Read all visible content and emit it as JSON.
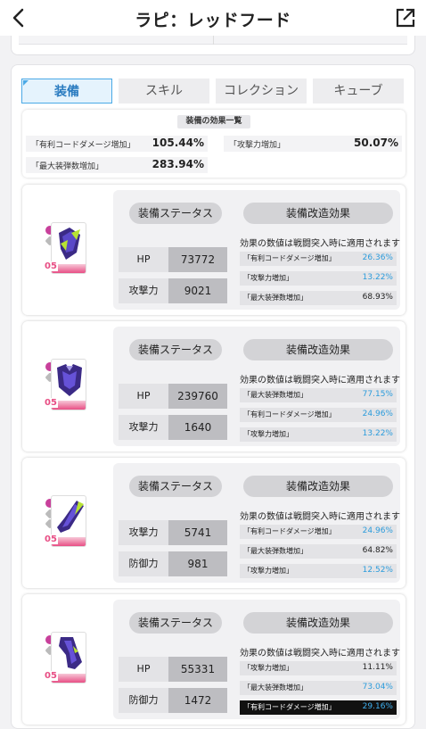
{
  "header": {
    "title": "ラピ：レッドフード",
    "back_icon": "chevron-left-icon",
    "share_icon": "external-link-icon"
  },
  "tabs": [
    {
      "label": "装備",
      "active": true
    },
    {
      "label": "スキル",
      "active": false
    },
    {
      "label": "コレクション",
      "active": false
    },
    {
      "label": "キューブ",
      "active": false
    }
  ],
  "effects_summary": {
    "title": "装備の効果一覧",
    "items": [
      {
        "label": "「有利コードダメージ増加」",
        "value": "105.44%"
      },
      {
        "label": "「攻撃力増加」",
        "value": "50.07%"
      },
      {
        "label": "「最大装弾数増加」",
        "value": "283.94%"
      }
    ]
  },
  "equipment": [
    {
      "level": "05",
      "status_label": "装備ステータス",
      "mod_label": "装備改造効果",
      "note": "効果の数値は戦闘突入時に適用されます",
      "stats": [
        {
          "label": "HP",
          "value": "73772"
        },
        {
          "label": "攻撃力",
          "value": "9021"
        }
      ],
      "mods": [
        {
          "label": "「有利コードダメージ増加」",
          "value": "26.36%",
          "color": "blue"
        },
        {
          "label": "「攻撃力増加」",
          "value": "13.22%",
          "color": "blue"
        },
        {
          "label": "「最大装弾数増加」",
          "value": "68.93%",
          "color": "black"
        }
      ]
    },
    {
      "level": "05",
      "status_label": "装備ステータス",
      "mod_label": "装備改造効果",
      "note": "効果の数値は戦闘突入時に適用されます",
      "stats": [
        {
          "label": "HP",
          "value": "239760"
        },
        {
          "label": "攻撃力",
          "value": "1640"
        }
      ],
      "mods": [
        {
          "label": "「最大装弾数増加」",
          "value": "77.15%",
          "color": "blue"
        },
        {
          "label": "「有利コードダメージ増加」",
          "value": "24.96%",
          "color": "blue"
        },
        {
          "label": "「攻撃力増加」",
          "value": "13.22%",
          "color": "blue"
        }
      ]
    },
    {
      "level": "05",
      "status_label": "装備ステータス",
      "mod_label": "装備改造効果",
      "note": "効果の数値は戦闘突入時に適用されます",
      "stats": [
        {
          "label": "攻撃力",
          "value": "5741"
        },
        {
          "label": "防御力",
          "value": "981"
        }
      ],
      "mods": [
        {
          "label": "「有利コードダメージ増加」",
          "value": "24.96%",
          "color": "blue"
        },
        {
          "label": "「最大装弾数増加」",
          "value": "64.82%",
          "color": "black"
        },
        {
          "label": "「攻撃力増加」",
          "value": "12.52%",
          "color": "blue"
        }
      ]
    },
    {
      "level": "05",
      "status_label": "装備ステータス",
      "mod_label": "装備改造効果",
      "note": "効果の数値は戦闘突入時に適用されます",
      "stats": [
        {
          "label": "HP",
          "value": "55331"
        },
        {
          "label": "防御力",
          "value": "1472"
        }
      ],
      "mods": [
        {
          "label": "「攻撃力増加」",
          "value": "11.11%",
          "color": "black"
        },
        {
          "label": "「最大装弾数増加」",
          "value": "73.04%",
          "color": "blue"
        },
        {
          "label": "「有利コードダメージ増加」",
          "value": "29.16%",
          "color": "blue",
          "highlight": true
        }
      ]
    }
  ],
  "colors": {
    "accent_blue": "#2c9cdc",
    "pink": "#e84f85",
    "highlight_bg": "#111111"
  }
}
